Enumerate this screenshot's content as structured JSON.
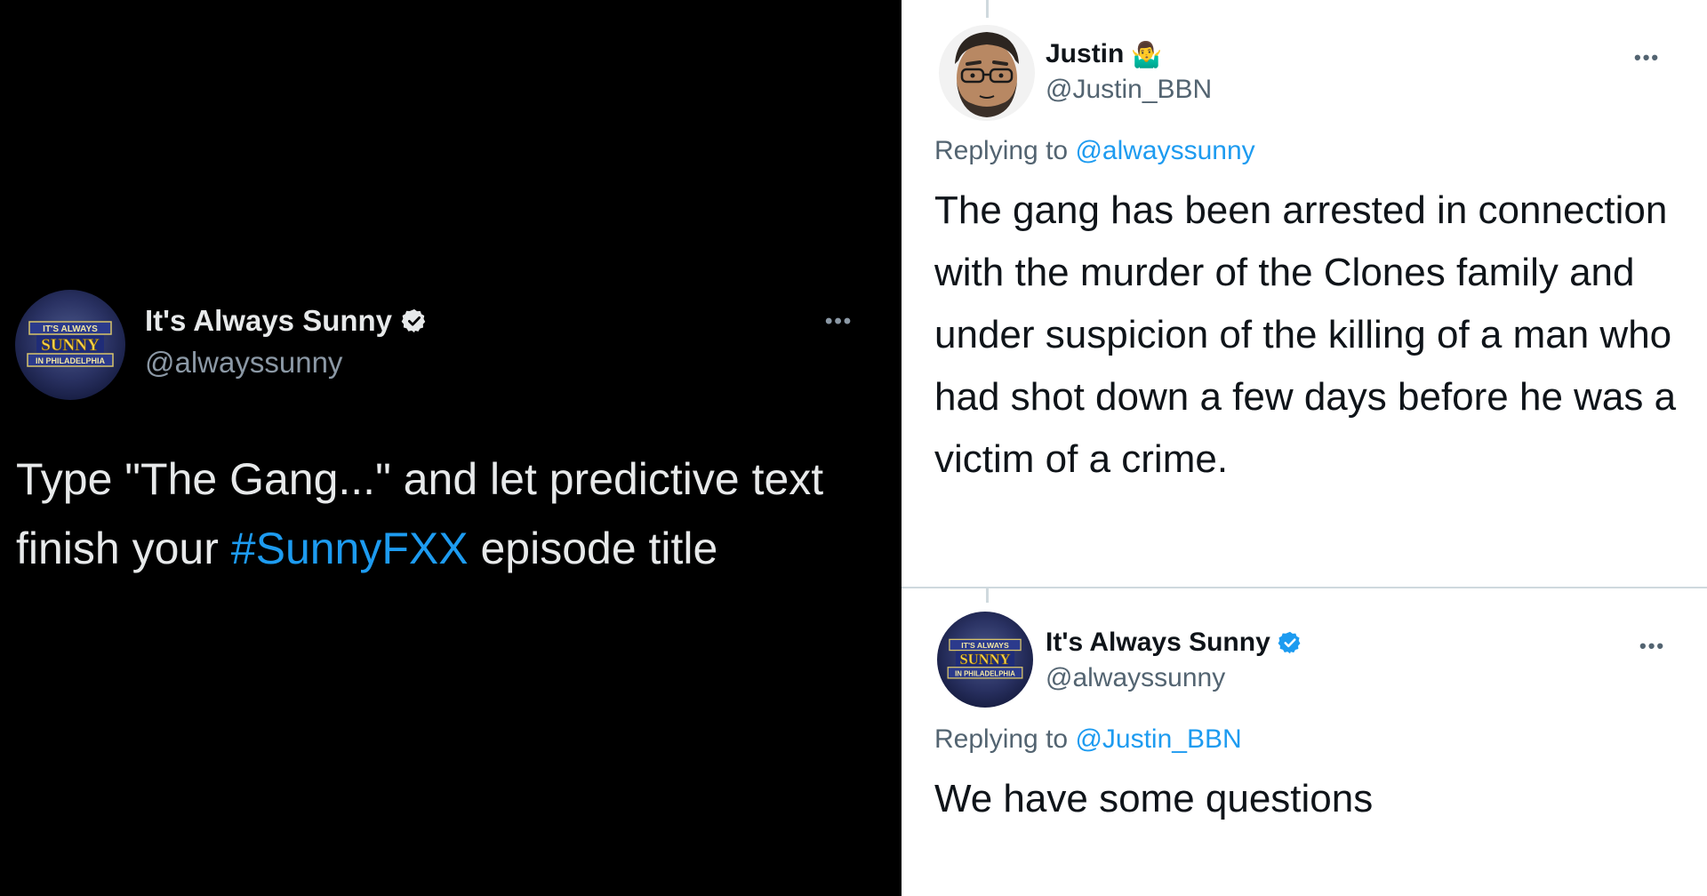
{
  "left_tweet": {
    "author_name": "It's Always Sunny",
    "author_handle": "@alwayssunny",
    "verified": true,
    "text_before": "Type \"The Gang...\" and let predictive text finish your ",
    "hashtag": "#SunnyFXX",
    "text_after": " episode title",
    "more_label": "•••",
    "avatar_logo_lines": [
      "IT'S ALWAYS",
      "SUNNY",
      "IN PHILADELPHIA"
    ]
  },
  "reply_one": {
    "author_name": "Justin",
    "author_emoji": "🤷‍♂️",
    "author_handle": "@Justin_BBN",
    "replying_to_label": "Replying to",
    "replying_to_handle": "@alwayssunny",
    "text": "The gang has been arrested in connection with the murder of the Clones family and under suspicion of the killing of a man who had shot down a few days before he was a victim of a crime.",
    "more_label": "•••"
  },
  "reply_two": {
    "author_name": "It's Always Sunny",
    "author_handle": "@alwayssunny",
    "verified": true,
    "replying_to_label": "Replying to",
    "replying_to_handle": "@Justin_BBN",
    "text": "We have some questions",
    "more_label": "•••",
    "avatar_logo_lines": [
      "IT'S ALWAYS",
      "SUNNY",
      "IN PHILADELPHIA"
    ]
  },
  "colors": {
    "dark_bg": "#000000",
    "light_bg": "#ffffff",
    "link_blue": "#1d9bf0",
    "verified_dark": "#e7e9ea",
    "verified_light": "#1d9bf0"
  }
}
